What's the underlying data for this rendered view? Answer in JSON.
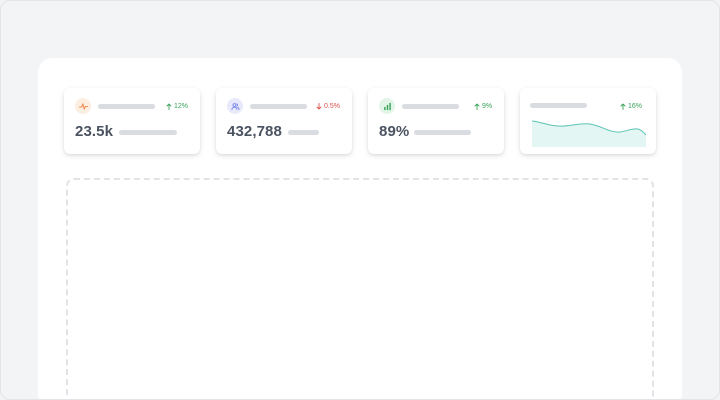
{
  "stats": [
    {
      "icon": "activity-icon",
      "accent": "#f4a261",
      "chip_bg": "#fdeee2",
      "trend_direction": "up",
      "trend_text": "12%",
      "value": "23.5k"
    },
    {
      "icon": "users-icon",
      "accent": "#6b78e5",
      "chip_bg": "#e8eafc",
      "trend_direction": "down",
      "trend_text": "0.5%",
      "value": "432,788"
    },
    {
      "icon": "bar-chart-icon",
      "accent": "#3aa35a",
      "chip_bg": "#e3f5e8",
      "trend_direction": "up",
      "trend_text": "9%",
      "value": "89%"
    },
    {
      "icon": "sparkline-icon",
      "trend_direction": "up",
      "trend_text": "16%"
    }
  ],
  "colors": {
    "up": "#3aa35a",
    "down": "#e0524d",
    "sparkline_stroke": "#5cc3b5",
    "sparkline_fill": "#e4f6f3"
  }
}
